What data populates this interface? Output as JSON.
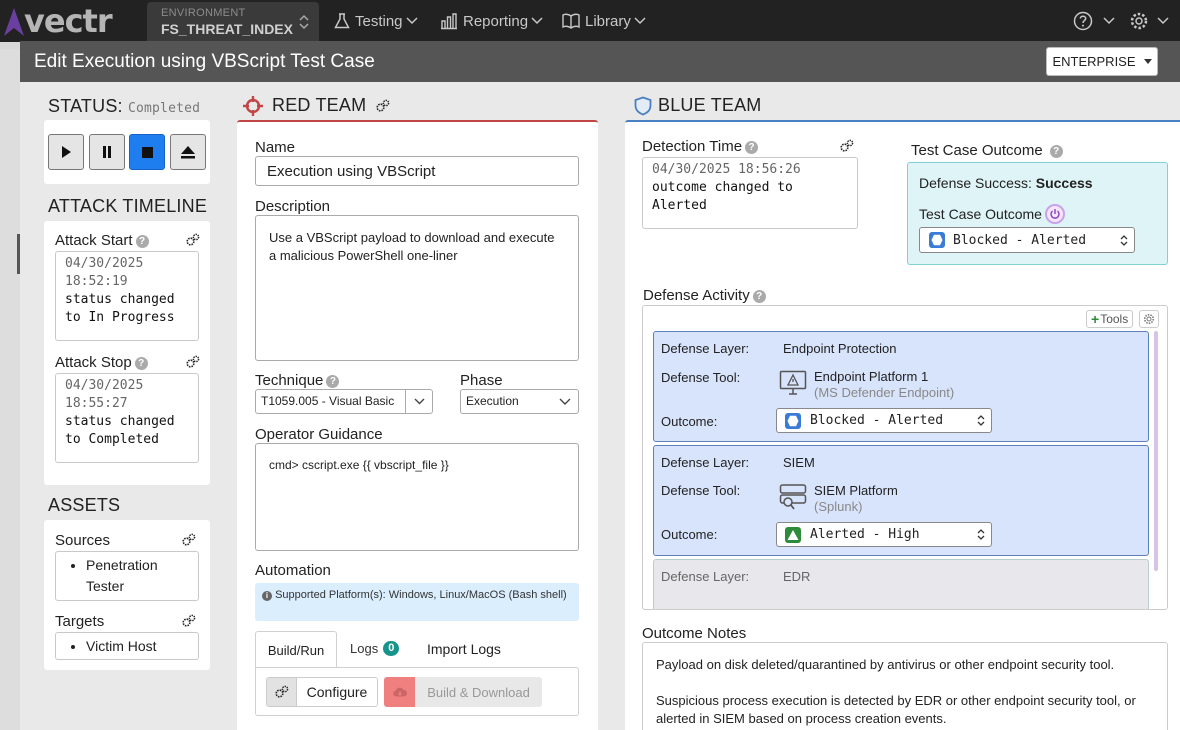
{
  "nav": {
    "brand": "vectr",
    "env_label": "ENVIRONMENT",
    "env_value": "FS_THREAT_INDEX",
    "items": [
      {
        "label": "Testing",
        "icon": "flask-icon"
      },
      {
        "label": "Reporting",
        "icon": "bar-chart-icon"
      },
      {
        "label": "Library",
        "icon": "book-icon"
      }
    ]
  },
  "modal": {
    "title": "Edit Execution using VBScript Test Case",
    "enterprise_label": "ENTERPRISE"
  },
  "status": {
    "label": "STATUS:",
    "value": "Completed",
    "active_control": "stop"
  },
  "timeline": {
    "heading": "ATTACK TIMELINE",
    "start": {
      "label": "Attack Start",
      "time": "04/30/2025 18:52:19",
      "note": "status changed to In Progress"
    },
    "stop": {
      "label": "Attack Stop",
      "time": "04/30/2025 18:55:27",
      "note": "status changed to Completed"
    }
  },
  "assets": {
    "heading": "ASSETS",
    "sources_label": "Sources",
    "sources": [
      "Penetration Tester"
    ],
    "targets_label": "Targets",
    "targets": [
      "Victim Host"
    ]
  },
  "red": {
    "heading": "RED TEAM",
    "name_label": "Name",
    "name_value": "Execution using VBScript",
    "desc_label": "Description",
    "desc_value": "Use a VBScript payload to download and execute a malicious PowerShell one-liner",
    "technique_label": "Technique",
    "technique_value": "T1059.005 - Visual Basic",
    "phase_label": "Phase",
    "phase_value": "Execution",
    "guidance_label": "Operator Guidance",
    "guidance_value": "cmd> cscript.exe {{ vbscript_file }}",
    "automation_label": "Automation",
    "automation_info": "Supported Platform(s): Windows, Linux/MacOS (Bash shell)",
    "tabs": [
      "Build/Run",
      "Logs",
      "Import Logs"
    ],
    "logs_count": "0",
    "configure_label": "Configure",
    "build_label": "Build & Download"
  },
  "blue": {
    "heading": "BLUE TEAM",
    "detection_label": "Detection Time",
    "detection_time": "04/30/2025 18:56:26",
    "detection_note": "outcome changed to Alerted",
    "outcome_heading": "Test Case Outcome",
    "defense_success_label": "Defense Success:",
    "defense_success_value": "Success",
    "outcome_label": "Test Case Outcome",
    "outcome_value": "Blocked - Alerted",
    "activity_label": "Defense Activity",
    "tools_btn": "Tools",
    "layers": [
      {
        "layer_label": "Defense Layer:",
        "layer": "Endpoint Protection",
        "tool_label": "Defense Tool:",
        "tool": "Endpoint Platform 1",
        "tool_sub": "(MS Defender Endpoint)",
        "outcome_label": "Outcome:",
        "outcome": "Blocked - Alerted"
      },
      {
        "layer_label": "Defense Layer:",
        "layer": "SIEM",
        "tool_label": "Defense Tool:",
        "tool": "SIEM Platform",
        "tool_sub": "(Splunk)",
        "outcome_label": "Outcome:",
        "outcome": "Alerted - High"
      },
      {
        "layer_label": "Defense Layer:",
        "layer": "EDR"
      }
    ],
    "notes_label": "Outcome Notes",
    "notes_p1": "Payload on disk deleted/quarantined by antivirus or other endpoint security tool.",
    "notes_p2": "Suspicious process execution is detected by EDR or other endpoint security tool, or alerted in SIEM based on process creation events."
  },
  "colors": {
    "nav_bg": "#222222",
    "accent_purple": "#6b3fa0",
    "red_team": "#c24545",
    "blue_team": "#4a7fc1",
    "stop_active": "#1e7ef0",
    "outcome_box": "#dff4f6",
    "layer_box": "#d8e4fb",
    "alert_green": "#2e8b3a"
  }
}
